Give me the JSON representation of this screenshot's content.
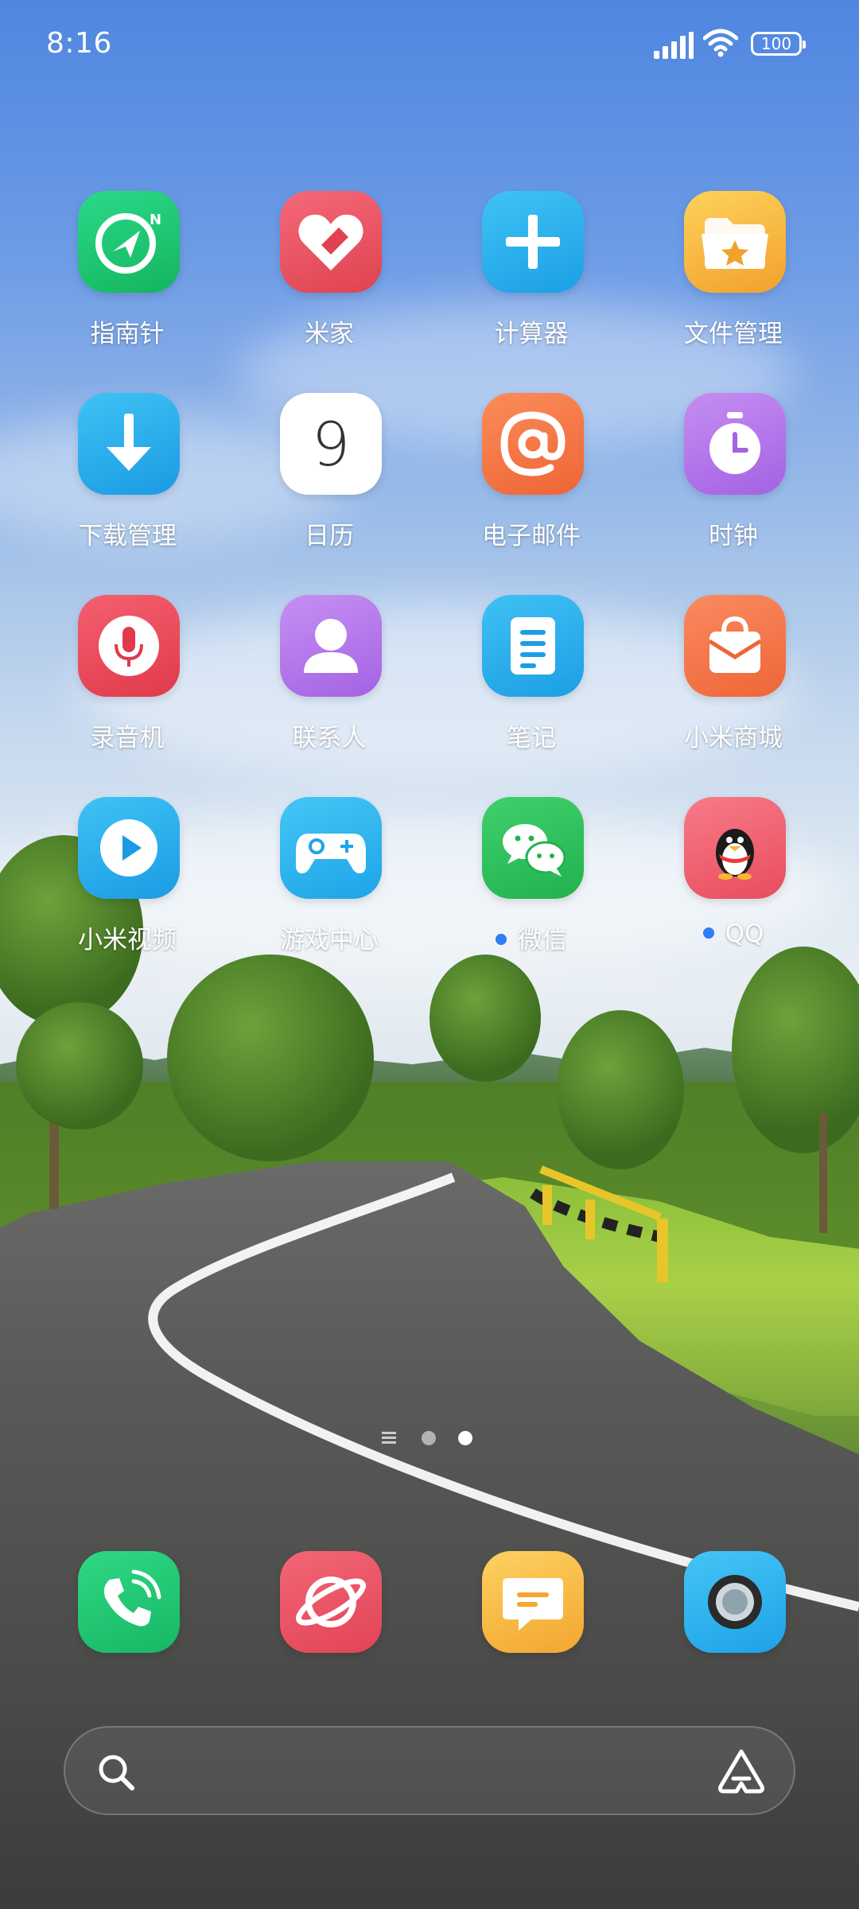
{
  "status": {
    "time": "8:16",
    "battery": "100"
  },
  "apps": [
    {
      "name": "compass",
      "label": "指南针",
      "icon": "compass-icon",
      "notification": false
    },
    {
      "name": "mijia",
      "label": "米家",
      "icon": "mijia-heart-icon",
      "notification": false
    },
    {
      "name": "calculator",
      "label": "计算器",
      "icon": "plus-icon",
      "notification": false
    },
    {
      "name": "file-manager",
      "label": "文件管理",
      "icon": "folder-star-icon",
      "notification": false
    },
    {
      "name": "downloads",
      "label": "下载管理",
      "icon": "download-arrow-icon",
      "notification": false
    },
    {
      "name": "calendar",
      "label": "日历",
      "icon": "calendar-icon",
      "date": "9",
      "notification": false
    },
    {
      "name": "email",
      "label": "电子邮件",
      "icon": "at-sign-icon",
      "notification": false
    },
    {
      "name": "clock",
      "label": "时钟",
      "icon": "stopwatch-icon",
      "notification": false
    },
    {
      "name": "recorder",
      "label": "录音机",
      "icon": "microphone-icon",
      "notification": false
    },
    {
      "name": "contacts",
      "label": "联系人",
      "icon": "person-icon",
      "notification": false
    },
    {
      "name": "notes",
      "label": "笔记",
      "icon": "notes-list-icon",
      "notification": false
    },
    {
      "name": "mi-store",
      "label": "小米商城",
      "icon": "shopping-bag-icon",
      "notification": false
    },
    {
      "name": "mi-video",
      "label": "小米视频",
      "icon": "play-icon",
      "notification": false
    },
    {
      "name": "game-center",
      "label": "游戏中心",
      "icon": "gamepad-icon",
      "notification": false
    },
    {
      "name": "wechat",
      "label": "微信",
      "icon": "wechat-icon",
      "notification": true
    },
    {
      "name": "qq",
      "label": "QQ",
      "icon": "qq-penguin-icon",
      "notification": true
    }
  ],
  "dock": [
    {
      "name": "phone",
      "icon": "phone-icon"
    },
    {
      "name": "browser",
      "icon": "planet-icon"
    },
    {
      "name": "messages",
      "icon": "message-icon"
    },
    {
      "name": "camera",
      "icon": "camera-lens-icon"
    }
  ],
  "colors": {
    "compass": "#1fc36f",
    "mijia": "#ea4e60",
    "calculator": "#27b2ee",
    "files": "#f5b83e",
    "downloads": "#27a9ee",
    "calendar": "#ffffff",
    "email": "#f47a4a",
    "clock": "#b578ea",
    "recorder": "#ea4a5b",
    "contacts": "#b57be9",
    "notes": "#27aeee",
    "store": "#f57a4e",
    "video": "#27a9ee",
    "game": "#2fb6f0",
    "wechat": "#2fc35e",
    "qq": "#f06272",
    "notify": "#2f7cf6"
  }
}
